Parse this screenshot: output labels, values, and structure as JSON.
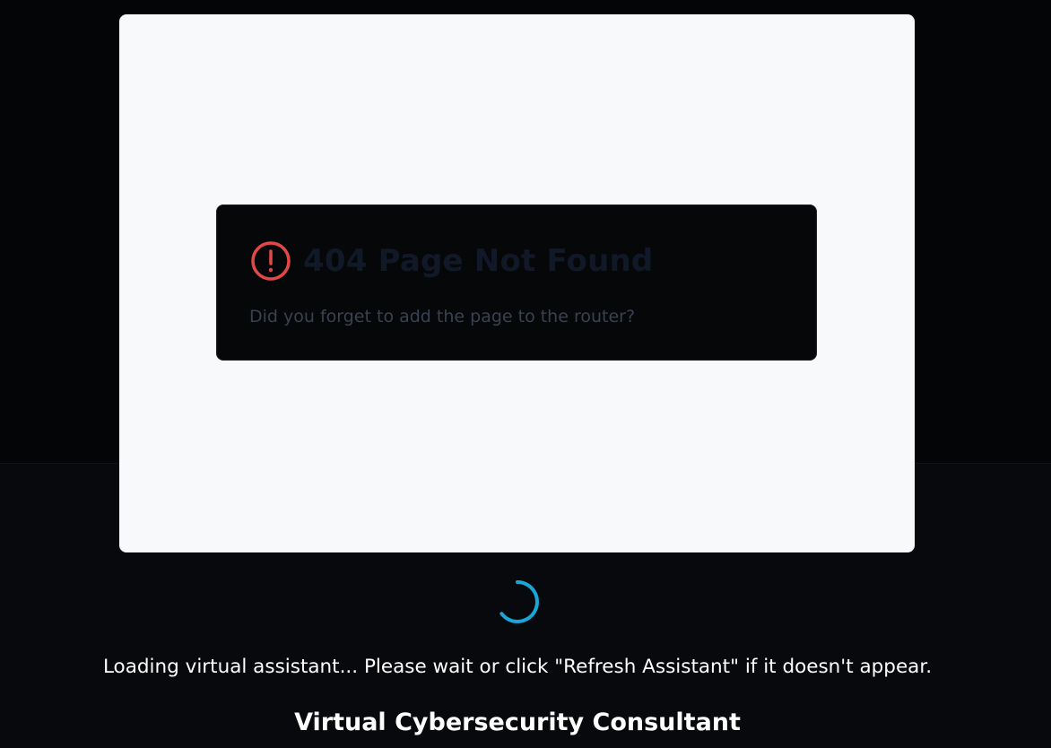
{
  "embedded_frame": {
    "error": {
      "icon": "alert-circle-icon",
      "title": "404 Page Not Found",
      "message": "Did you forget to add the page to the router?"
    }
  },
  "loader": {
    "icon": "loading-spinner-icon",
    "message": "Loading virtual assistant... Please wait or click \"Refresh Assistant\" if it doesn't appear."
  },
  "assistant": {
    "title": "Virtual Cybersecurity Consultant"
  },
  "colors": {
    "page_background": "#08090c",
    "frame_background": "#f8f9fb",
    "card_background": "#060709",
    "error_accent": "#e24848",
    "spinner_accent": "#1ba6d9",
    "text_primary": "#ffffff"
  }
}
